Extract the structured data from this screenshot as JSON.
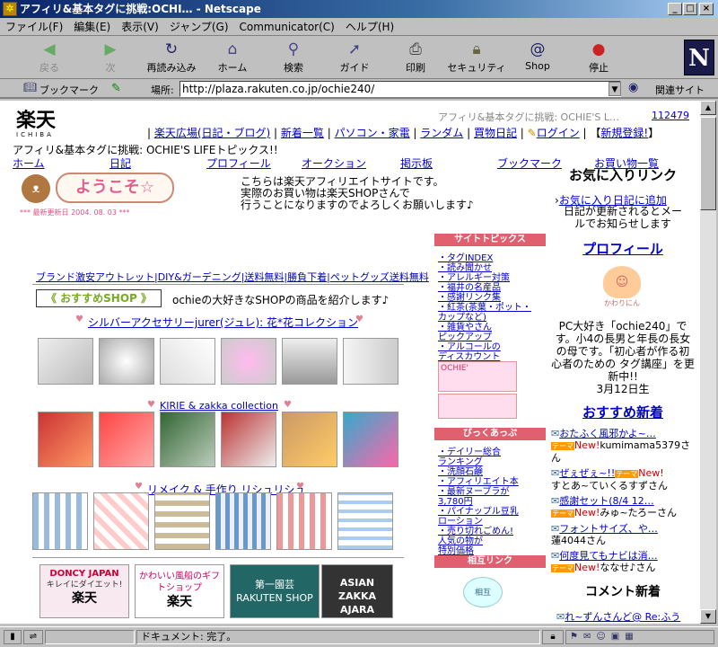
{
  "window": {
    "title": "アフィリ&基本タグに挑戦:OCHI… - Netscape"
  },
  "menu": [
    "ファイル(F)",
    "編集(E)",
    "表示(V)",
    "ジャンプ(G)",
    "Communicator(C)",
    "ヘルプ(H)"
  ],
  "toolbar": [
    {
      "label": "戻る",
      "icon": "back-arrow-icon"
    },
    {
      "label": "次",
      "icon": "forward-arrow-icon"
    },
    {
      "label": "再読み込み",
      "icon": "reload-icon"
    },
    {
      "label": "ホーム",
      "icon": "home-icon"
    },
    {
      "label": "検索",
      "icon": "search-icon"
    },
    {
      "label": "ガイド",
      "icon": "guide-icon"
    },
    {
      "label": "印刷",
      "icon": "print-icon"
    },
    {
      "label": "セキュリティ",
      "icon": "lock-icon"
    },
    {
      "label": "Shop",
      "icon": "shop-icon"
    },
    {
      "label": "停止",
      "icon": "stop-icon"
    }
  ],
  "location": {
    "bookmark": "ブックマーク",
    "label": "場所:",
    "url": "http://plaza.rakuten.co.jp/ochie240/",
    "related": "関連サイト"
  },
  "page": {
    "logo_top": "楽天",
    "logo_bottom": "ICHIBA",
    "blog_title_right": "アフィリ&基本タグに挑戦: OCHIE'S L…",
    "counter": "112479",
    "nav_links": [
      "楽天広場(日記・ブログ)",
      "新着一覧",
      "パソコン・家電",
      "ランダム",
      "買物日記",
      "ログイン",
      "新規登録!"
    ],
    "blog_title": "アフィリ&基本タグに挑戦: OCHIE'S LIFEトピックス!!",
    "tabs": [
      "ホーム",
      "日記",
      "プロフィール",
      "オークション",
      "掲示板",
      "ブックマーク",
      "お買い物一覧"
    ],
    "welcome": "ようこそ☆",
    "updated": "*** 最新更新日 2004. 08. 03 ***",
    "intro": [
      "こちらは楽天アフィリエイトサイトです。",
      "実際のお買い物は楽天SHOPさんで",
      "行うことになりますのでよろしくお願いします♪"
    ],
    "shop_links": "ブランド激安アウトレット|DIY&ガーデニング|送料無料|勝負下着|ペットグッズ送料無料",
    "recommend_badge": "《 おすすめSHOP 》",
    "recommend_text": "ochieの大好きなSHOPの商品を紹介します♪",
    "section1": "シルバーアクセサリーjurer(ジュレ): 花*花コレクション",
    "section2": "KIRIE & zakka collection",
    "section3": "リメイク & 手作り リシュリシュ",
    "banners": [
      "DONCY JAPAN",
      "かわいい風船のギフトショップ",
      "第一園芸 RAKUTEN SHOP",
      "ASIAN ZAKKA AJARA"
    ],
    "banner1_sub": "キレイにダイエット!",
    "banner1_brand": "楽天",
    "banner2_brand": "楽天"
  },
  "side": {
    "topics_title": "サイトトピックス",
    "topics": [
      "・タグINDEX",
      "・読み聞かせ",
      "・アレルギー対策",
      "・福井の名産品",
      "・感謝リンク集",
      "・紅茶(茶葉・ポット・",
      "  カップなど)",
      "・雑貨やさん",
      "  ピックアップ",
      "・アルコールの",
      "  ディスカウント"
    ],
    "bikkuri_title": "びっくあっぷ",
    "bikkuri": [
      "・デイリー総合",
      "  ランキング",
      "・洗顔石鹸",
      "・アフィリエイト本",
      "・最新ヌーブラが",
      "  3,780円",
      "・パイナップル豆乳",
      "  ローション",
      "・売り切れごめん!",
      "  人気の物が",
      "  特別価格"
    ],
    "mutual_title": "相互リンク",
    "ochie_banner": "OCHIE'",
    "mutual_badge": "相互"
  },
  "right": {
    "fav_title": "お気に入りリンク",
    "fav_link": "お気に入り日記に追加",
    "fav_note": "日記が更新されるとメールでお知らせします",
    "profile_title": "プロフィール",
    "avatar_label": "かわりにん",
    "profile_text": "PC大好き「ochie240」です。小4の長男と年長の長女の母です。「初心者が作る初心者のための タグ講座」を更新中!!",
    "profile_date": "3月12日生",
    "new_title": "おすすめ新着",
    "new_items": [
      {
        "title": "おたふく風邪かよ~…",
        "user": "kumimama5379さん"
      },
      {
        "title": "ぜぇぜぇ~!!",
        "user": "すとあ~ていくるすずさん"
      },
      {
        "title": "感謝セット(8/4 12…",
        "user": "みゅ~たろーさん"
      },
      {
        "title": "フォントサイズ、や…",
        "user": "蓮4044さん"
      },
      {
        "title": "何度見てもナビは消…",
        "user": "ななせ♪さん"
      }
    ],
    "badge_theme": "テーマ",
    "badge_new": "New!",
    "comment_title": "コメント新着",
    "comment_item": "れ~ずんさんど@ Re:ふう"
  },
  "status": {
    "text": "ドキュメント: 完了。"
  }
}
